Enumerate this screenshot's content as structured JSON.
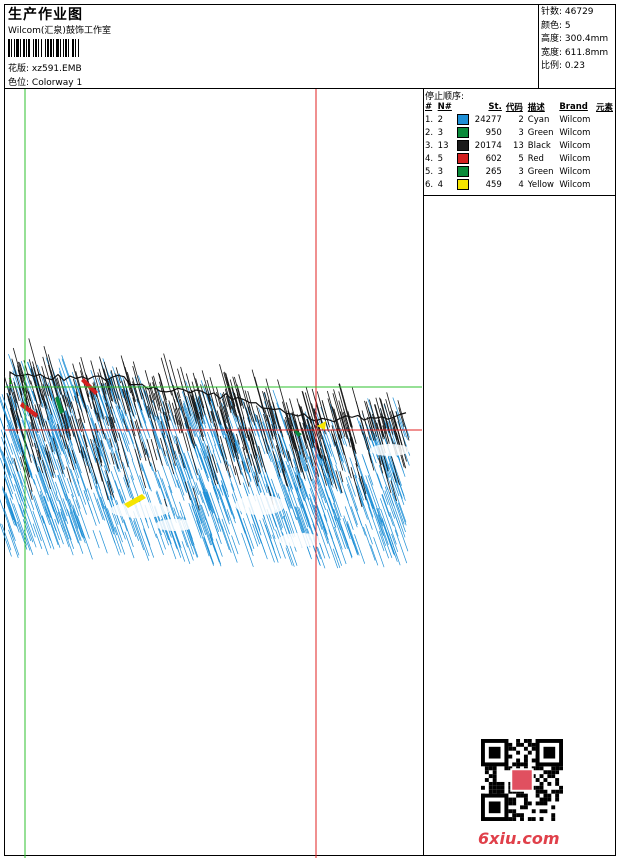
{
  "header": {
    "title": "生产作业图",
    "studio": "Wilcom(汇泉)鼓饰工作室",
    "design_label": "花版:",
    "design_value": "xz591.EMB",
    "colorway_label": "色位:",
    "colorway_value": "Colorway 1"
  },
  "stats": {
    "stitches": "针数: 46729",
    "colors": "颜色: 5",
    "height": "高度: 300.4mm",
    "width": "宽度: 611.8mm",
    "scale": "比例: 0.23"
  },
  "sequence": {
    "title": "停止顺序:",
    "headers": [
      "#",
      "N#",
      "St.",
      "代码",
      "描述",
      "Brand",
      "元素"
    ],
    "rows": [
      {
        "idx": "1.",
        "n": "2",
        "color": "#1e8fd6",
        "st": "24277",
        "code": "2",
        "desc": "Cyan",
        "brand": "Wilcom"
      },
      {
        "idx": "2.",
        "n": "3",
        "color": "#0a8a3a",
        "st": "950",
        "code": "3",
        "desc": "Green",
        "brand": "Wilcom"
      },
      {
        "idx": "3.",
        "n": "13",
        "color": "#1a1a1a",
        "st": "20174",
        "code": "13",
        "desc": "Black",
        "brand": "Wilcom"
      },
      {
        "idx": "4.",
        "n": "5",
        "color": "#d42020",
        "st": "602",
        "code": "5",
        "desc": "Red",
        "brand": "Wilcom"
      },
      {
        "idx": "5.",
        "n": "3",
        "color": "#0a8a3a",
        "st": "265",
        "code": "3",
        "desc": "Green",
        "brand": "Wilcom"
      },
      {
        "idx": "6.",
        "n": "4",
        "color": "#f5e400",
        "st": "459",
        "code": "4",
        "desc": "Yellow",
        "brand": "Wilcom"
      }
    ]
  },
  "canvas": {
    "guide_marker": "1"
  },
  "watermark": {
    "site": "6xiu.com"
  }
}
